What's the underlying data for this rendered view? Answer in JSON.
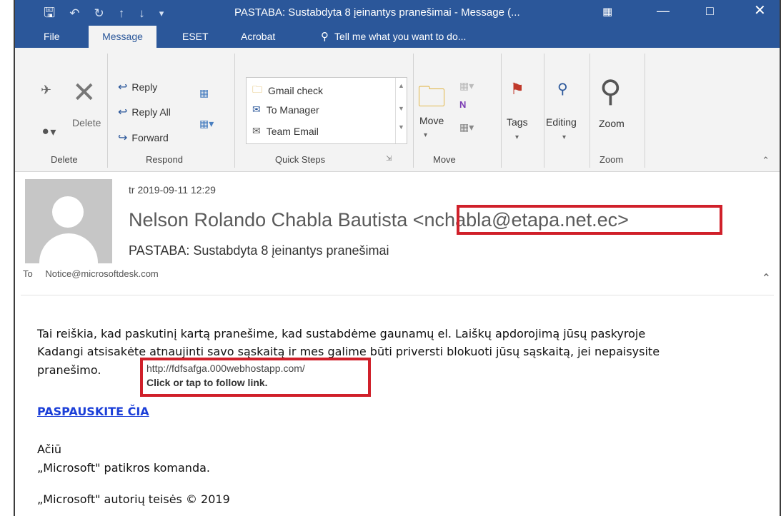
{
  "window": {
    "title": "PASTABA: Sustabdyta 8 įeinantys pranešimai - Message (...",
    "accent": "#2b579a"
  },
  "quick_access": {
    "icons": [
      "save-icon",
      "undo-icon",
      "redo-icon",
      "up-arrow-icon",
      "down-arrow-icon",
      "customize-icon"
    ]
  },
  "tabs": [
    {
      "label": "File"
    },
    {
      "label": "Message"
    },
    {
      "label": "ESET"
    },
    {
      "label": "Acrobat"
    },
    {
      "label": "Tell me what you want to do..."
    }
  ],
  "ribbon": {
    "delete_group": {
      "delete_label": "Delete",
      "group_label": "Delete"
    },
    "respond_group": {
      "reply": "Reply",
      "reply_all": "Reply All",
      "forward": "Forward",
      "group_label": "Respond"
    },
    "quick_steps": {
      "items": [
        "Gmail check",
        "To Manager",
        "Team Email"
      ],
      "group_label": "Quick Steps"
    },
    "move_group": {
      "move_label": "Move",
      "group_label": "Move"
    },
    "tags_label": "Tags",
    "editing_label": "Editing",
    "zoom_group": {
      "zoom_label": "Zoom",
      "group_label": "Zoom"
    }
  },
  "message": {
    "date": "tr 2019-09-11 12:29",
    "sender_name": "Nelson Rolando Chabla Bautista",
    "sender_email": "<nchabla@etapa.net.ec>",
    "subject": "PASTABA: Sustabdyta 8 įeinantys pranešimai",
    "to_label": "To",
    "to_value": "Notice@microsoftdesk.com"
  },
  "body": {
    "line1": "Tai reiškia, kad paskutinį kartą pranešime, kad sustabdėme gaunamų el. Laiškų apdorojimą jūsų paskyroje",
    "line2": "Kadangi atsisakėte atnaujinti savo sąskaitą ir mes galime būti priversti blokuoti jūsų sąskaitą, jei nepaisysite",
    "line3": "pranešimo.",
    "link": "PASPAUSKITE ČIA",
    "thanks": "Ačiū",
    "team": "„Microsoft\" patikros komanda.",
    "copyright": "„Microsoft\" autorių teisės © 2019"
  },
  "tooltip": {
    "url": "http://fdfsafga.000webhostapp.com/",
    "hint": "Click or tap to follow link."
  },
  "highlight_color": "#d0202a",
  "link_color": "#1c3fd8"
}
